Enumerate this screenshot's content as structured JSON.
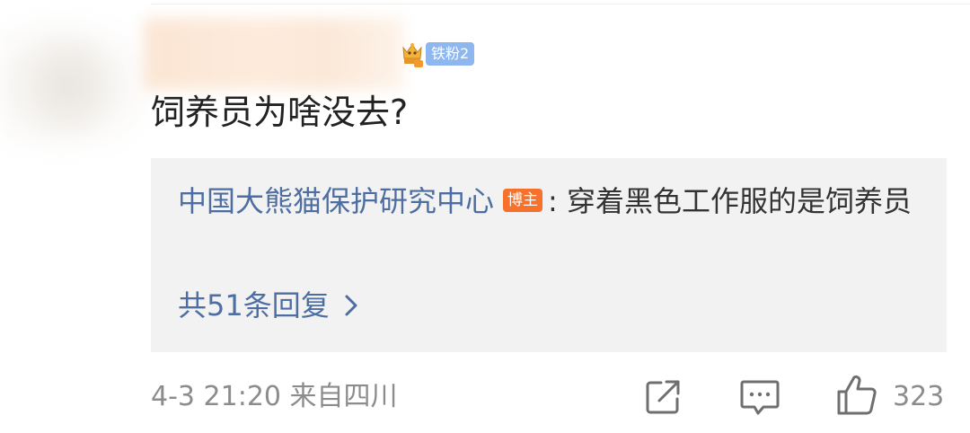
{
  "comment": {
    "author": "",
    "fan_badge": {
      "icon": "crown-badge-icon",
      "label": "铁粉2",
      "color": "#8eb7f0"
    },
    "text": "饲养员为啥没去?"
  },
  "reply": {
    "author": "中国大熊猫保护研究中心",
    "author_badge": "博主",
    "separator": ":",
    "text": "穿着黑色工作服的是饲养员",
    "more_replies": "共51条回复",
    "more_icon": "chevron-right-icon",
    "link_color": "#4e6ea2",
    "badge_color": "#f5712c"
  },
  "footer": {
    "time_location": "4-3 21:20  来自四川",
    "share_icon": "share-icon",
    "comment_icon": "comment-icon",
    "like_icon": "thumbs-up-icon",
    "like_count": "323"
  }
}
